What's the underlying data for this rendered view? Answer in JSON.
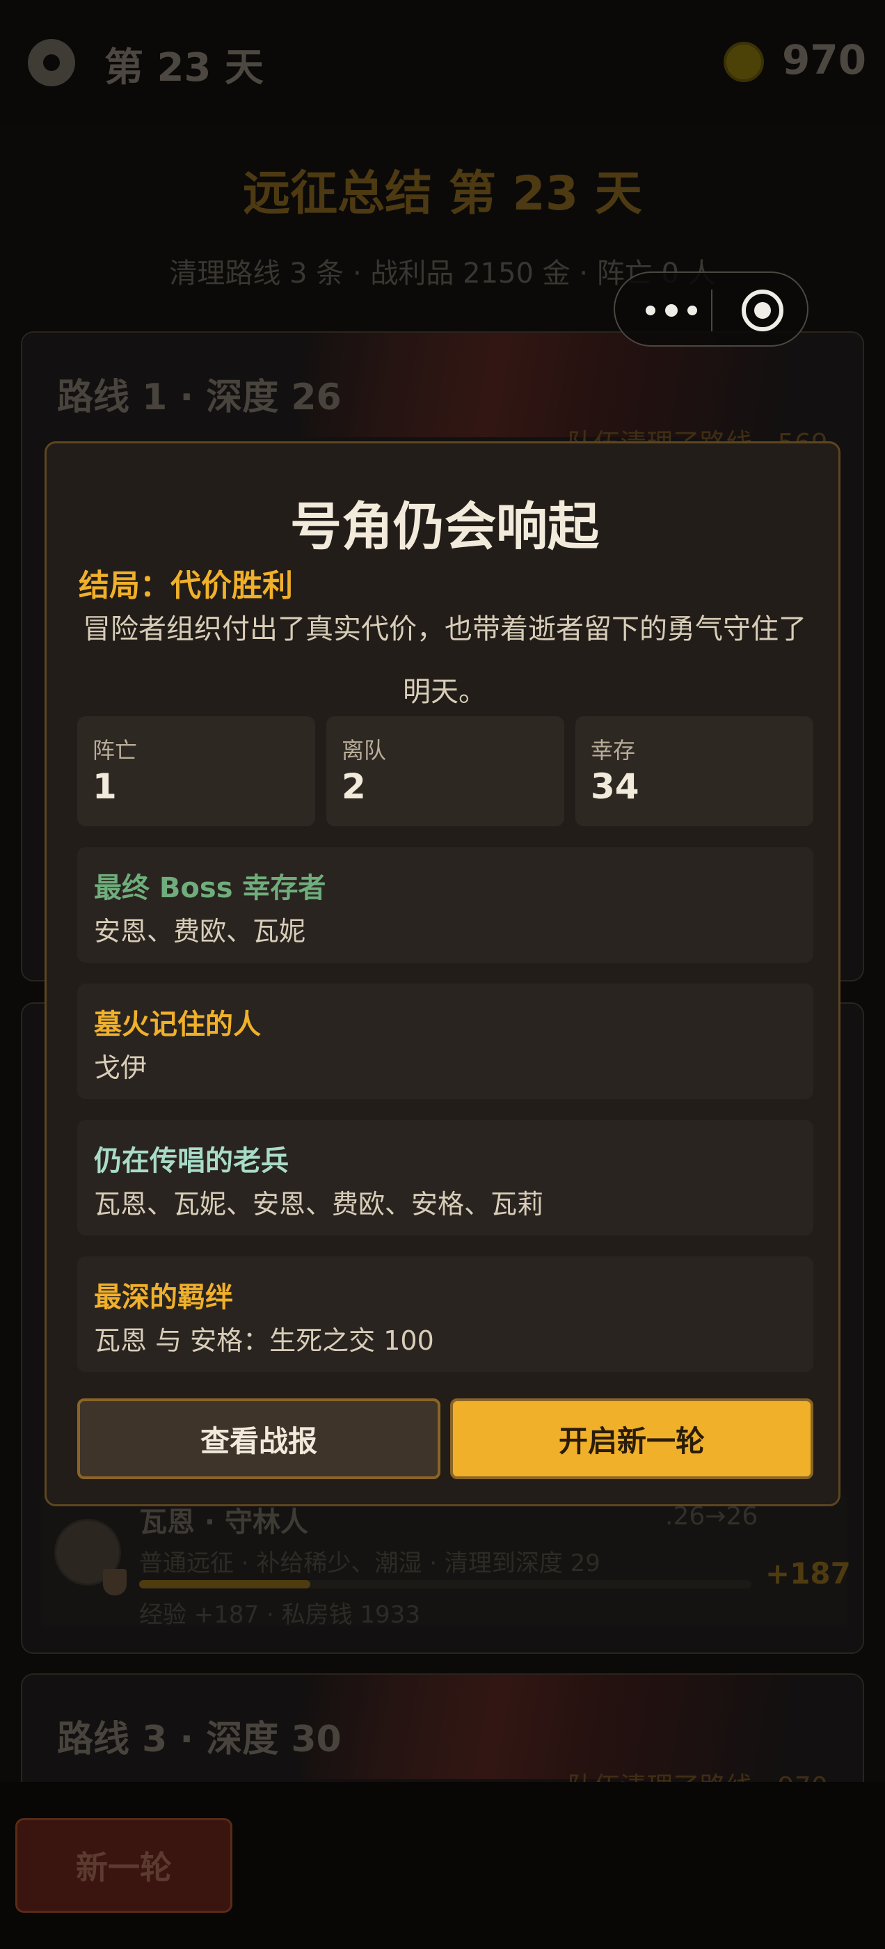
{
  "header": {
    "day_title": "第 23 天",
    "gold": "970"
  },
  "summary": {
    "title": "远征总结 第 23 天",
    "subtitle": "清理路线 3 条 · 战利品 2150 金 · 阵亡 0 人"
  },
  "routes": [
    {
      "heading": "路线 1 · 深度 26",
      "note": "队伍清理了路线 · 569"
    },
    {
      "heading": "路线 3 · 深度 30",
      "note": "队伍清理了路线 · 970"
    }
  ],
  "adventurer": {
    "name": "瓦恩 · 守林人",
    "range": ".26→26",
    "line2": "普通远征 · 补给稀少、潮湿 · 清理到深度 29",
    "progress": 0.28,
    "line3": "经验 +187 · 私房钱 1933",
    "gain": "+187"
  },
  "bottom": {
    "new_round": "新一轮"
  },
  "modal": {
    "title": "号角仍会响起",
    "ending": "结局：代价胜利",
    "ending_desc": "冒险者组织付出了真实代价，也带着逝者留下的勇气守住了明天。",
    "stats": [
      {
        "label": "阵亡",
        "value": "1"
      },
      {
        "label": "离队",
        "value": "2"
      },
      {
        "label": "幸存",
        "value": "34"
      }
    ],
    "sections": [
      {
        "heading": "最终 Boss 幸存者",
        "body": "安恩、费欧、瓦妮",
        "color": "#6fae7c"
      },
      {
        "heading": "墓火记住的人",
        "body": "戈伊",
        "color": "#f0b02a"
      },
      {
        "heading": "仍在传唱的老兵",
        "body": "瓦恩、瓦妮、安恩、费欧、安格、瓦莉",
        "color": "#a8dcc8"
      },
      {
        "heading": "最深的羁绊",
        "body": "瓦恩 与 安格：生死之交 100",
        "color": "#f0b02a"
      }
    ],
    "btn_view": "查看战报",
    "btn_new": "开启新一轮"
  }
}
